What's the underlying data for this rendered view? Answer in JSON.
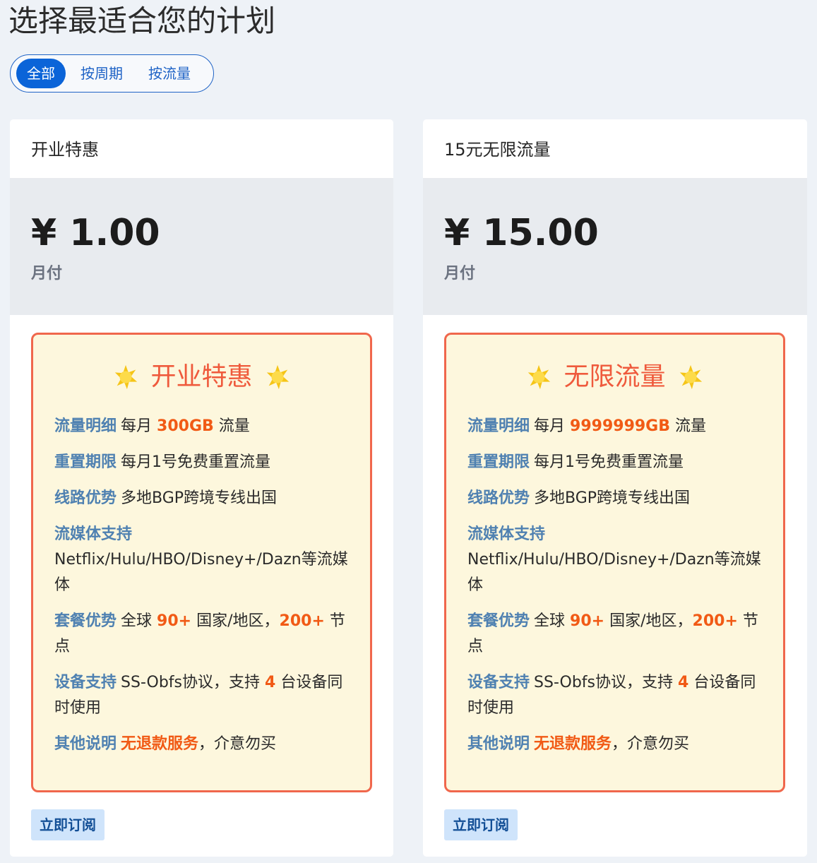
{
  "page_title": "选择最适合您的计划",
  "filters": [
    {
      "label": "全部",
      "active": true
    },
    {
      "label": "按周期",
      "active": false
    },
    {
      "label": "按流量",
      "active": false
    }
  ],
  "colors": {
    "accent": "#0b64d8",
    "feature_border": "#f0674c",
    "feature_bg": "#fdf7dd",
    "highlight": "#f15a15",
    "label_blue": "#4f81b1",
    "button_bg": "#cfe4fb"
  },
  "plans": [
    {
      "title": "开业特惠",
      "price": "¥ 1.00",
      "period": "月付",
      "feature_heading": "开业特惠",
      "icons": [
        "sparkle-icon",
        "sparkle-icon"
      ],
      "features": {
        "traffic": {
          "label": "流量明细",
          "pre": "每月",
          "hl": "300GB",
          "post": "流量"
        },
        "reset": {
          "label": "重置期限",
          "text": "每月1号免费重置流量"
        },
        "route": {
          "label": "线路优势",
          "text": "多地BGP跨境专线出国"
        },
        "streaming": {
          "label": "流媒体支持",
          "text": "Netflix/Hulu/HBO/Disney+/Dazn等流媒体"
        },
        "package": {
          "label": "套餐优势",
          "pre": "全球",
          "hl1": "90+",
          "mid": "国家/地区，",
          "hl2": "200+",
          "post": "节点"
        },
        "devices": {
          "label": "设备支持",
          "pre": "SS-Obfs协议，支持",
          "hl": "4",
          "post": "台设备同时使用"
        },
        "other": {
          "label": "其他说明",
          "hl": "无退款服务",
          "post": "，介意勿买"
        }
      },
      "button": "立即订阅"
    },
    {
      "title": "15元无限流量",
      "price": "¥ 15.00",
      "period": "月付",
      "feature_heading": "无限流量",
      "icons": [
        "sparkle-icon",
        "sparkle-icon"
      ],
      "features": {
        "traffic": {
          "label": "流量明细",
          "pre": "每月",
          "hl": "9999999GB",
          "post": "流量"
        },
        "reset": {
          "label": "重置期限",
          "text": "每月1号免费重置流量"
        },
        "route": {
          "label": "线路优势",
          "text": "多地BGP跨境专线出国"
        },
        "streaming": {
          "label": "流媒体支持",
          "text": "Netflix/Hulu/HBO/Disney+/Dazn等流媒体"
        },
        "package": {
          "label": "套餐优势",
          "pre": "全球",
          "hl1": "90+",
          "mid": "国家/地区，",
          "hl2": "200+",
          "post": "节点"
        },
        "devices": {
          "label": "设备支持",
          "pre": "SS-Obfs协议，支持",
          "hl": "4",
          "post": "台设备同时使用"
        },
        "other": {
          "label": "其他说明",
          "hl": "无退款服务",
          "post": "，介意勿买"
        }
      },
      "button": "立即订阅"
    }
  ]
}
